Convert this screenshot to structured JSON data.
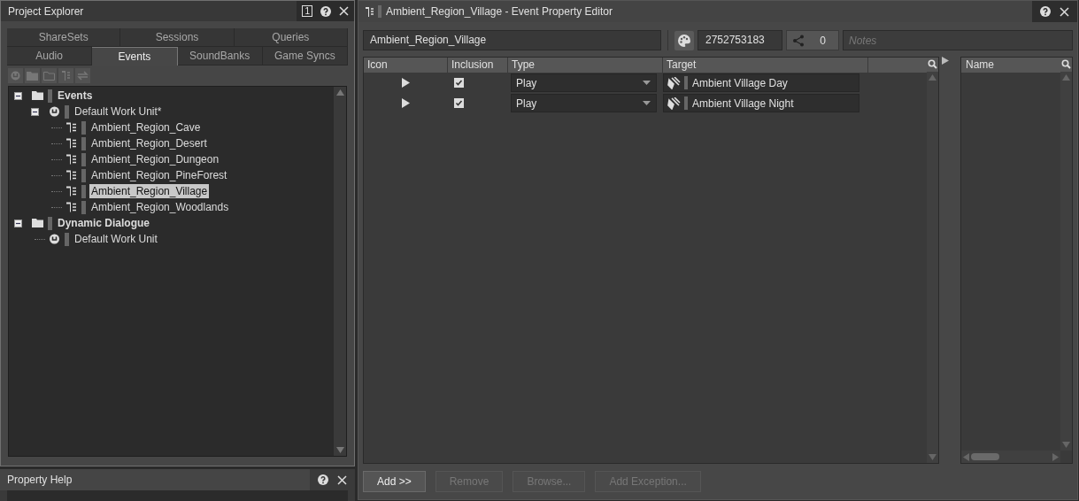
{
  "project_explorer": {
    "title": "Project Explorer",
    "badge": "1",
    "tab_rows": [
      [
        {
          "label": "ShareSets",
          "selected": false
        },
        {
          "label": "Sessions",
          "selected": false
        },
        {
          "label": "Queries",
          "selected": false
        }
      ],
      [
        {
          "label": "Audio",
          "selected": false
        },
        {
          "label": "Events",
          "selected": true
        },
        {
          "label": "SoundBanks",
          "selected": false
        },
        {
          "label": "Game Syncs",
          "selected": false
        }
      ]
    ],
    "tree": [
      {
        "label": "Events",
        "kind": "folder",
        "expanded": true,
        "selected": false,
        "children": [
          {
            "label": "Default Work Unit*",
            "kind": "workunit",
            "expanded": true,
            "selected": false,
            "children": [
              {
                "label": "Ambient_Region_Cave",
                "kind": "event",
                "selected": false
              },
              {
                "label": "Ambient_Region_Desert",
                "kind": "event",
                "selected": false
              },
              {
                "label": "Ambient_Region_Dungeon",
                "kind": "event",
                "selected": false
              },
              {
                "label": "Ambient_Region_PineForest",
                "kind": "event",
                "selected": false
              },
              {
                "label": "Ambient_Region_Village",
                "kind": "event",
                "selected": true
              },
              {
                "label": "Ambient_Region_Woodlands",
                "kind": "event",
                "selected": false
              }
            ]
          }
        ]
      },
      {
        "label": "Dynamic Dialogue",
        "kind": "folder",
        "expanded": true,
        "selected": false,
        "children": [
          {
            "label": "Default Work Unit",
            "kind": "workunit",
            "selected": false
          }
        ]
      }
    ]
  },
  "property_help": {
    "title": "Property Help"
  },
  "editor": {
    "title": "Ambient_Region_Village - Event Property Editor",
    "name": "Ambient_Region_Village",
    "id": "2752753183",
    "references": "0",
    "notes_placeholder": "Notes",
    "columns": [
      "Icon",
      "Inclusion",
      "Type",
      "Target"
    ],
    "rows": [
      {
        "included": true,
        "type": "Play",
        "target": "Ambient Village Day"
      },
      {
        "included": true,
        "type": "Play",
        "target": "Ambient Village Night"
      }
    ],
    "side_columns": [
      "Name"
    ],
    "buttons": [
      {
        "label": "Add >>",
        "disabled": false
      },
      {
        "label": "Remove",
        "disabled": true
      },
      {
        "label": "Browse...",
        "disabled": true
      },
      {
        "label": "Add Exception...",
        "disabled": true
      }
    ]
  }
}
